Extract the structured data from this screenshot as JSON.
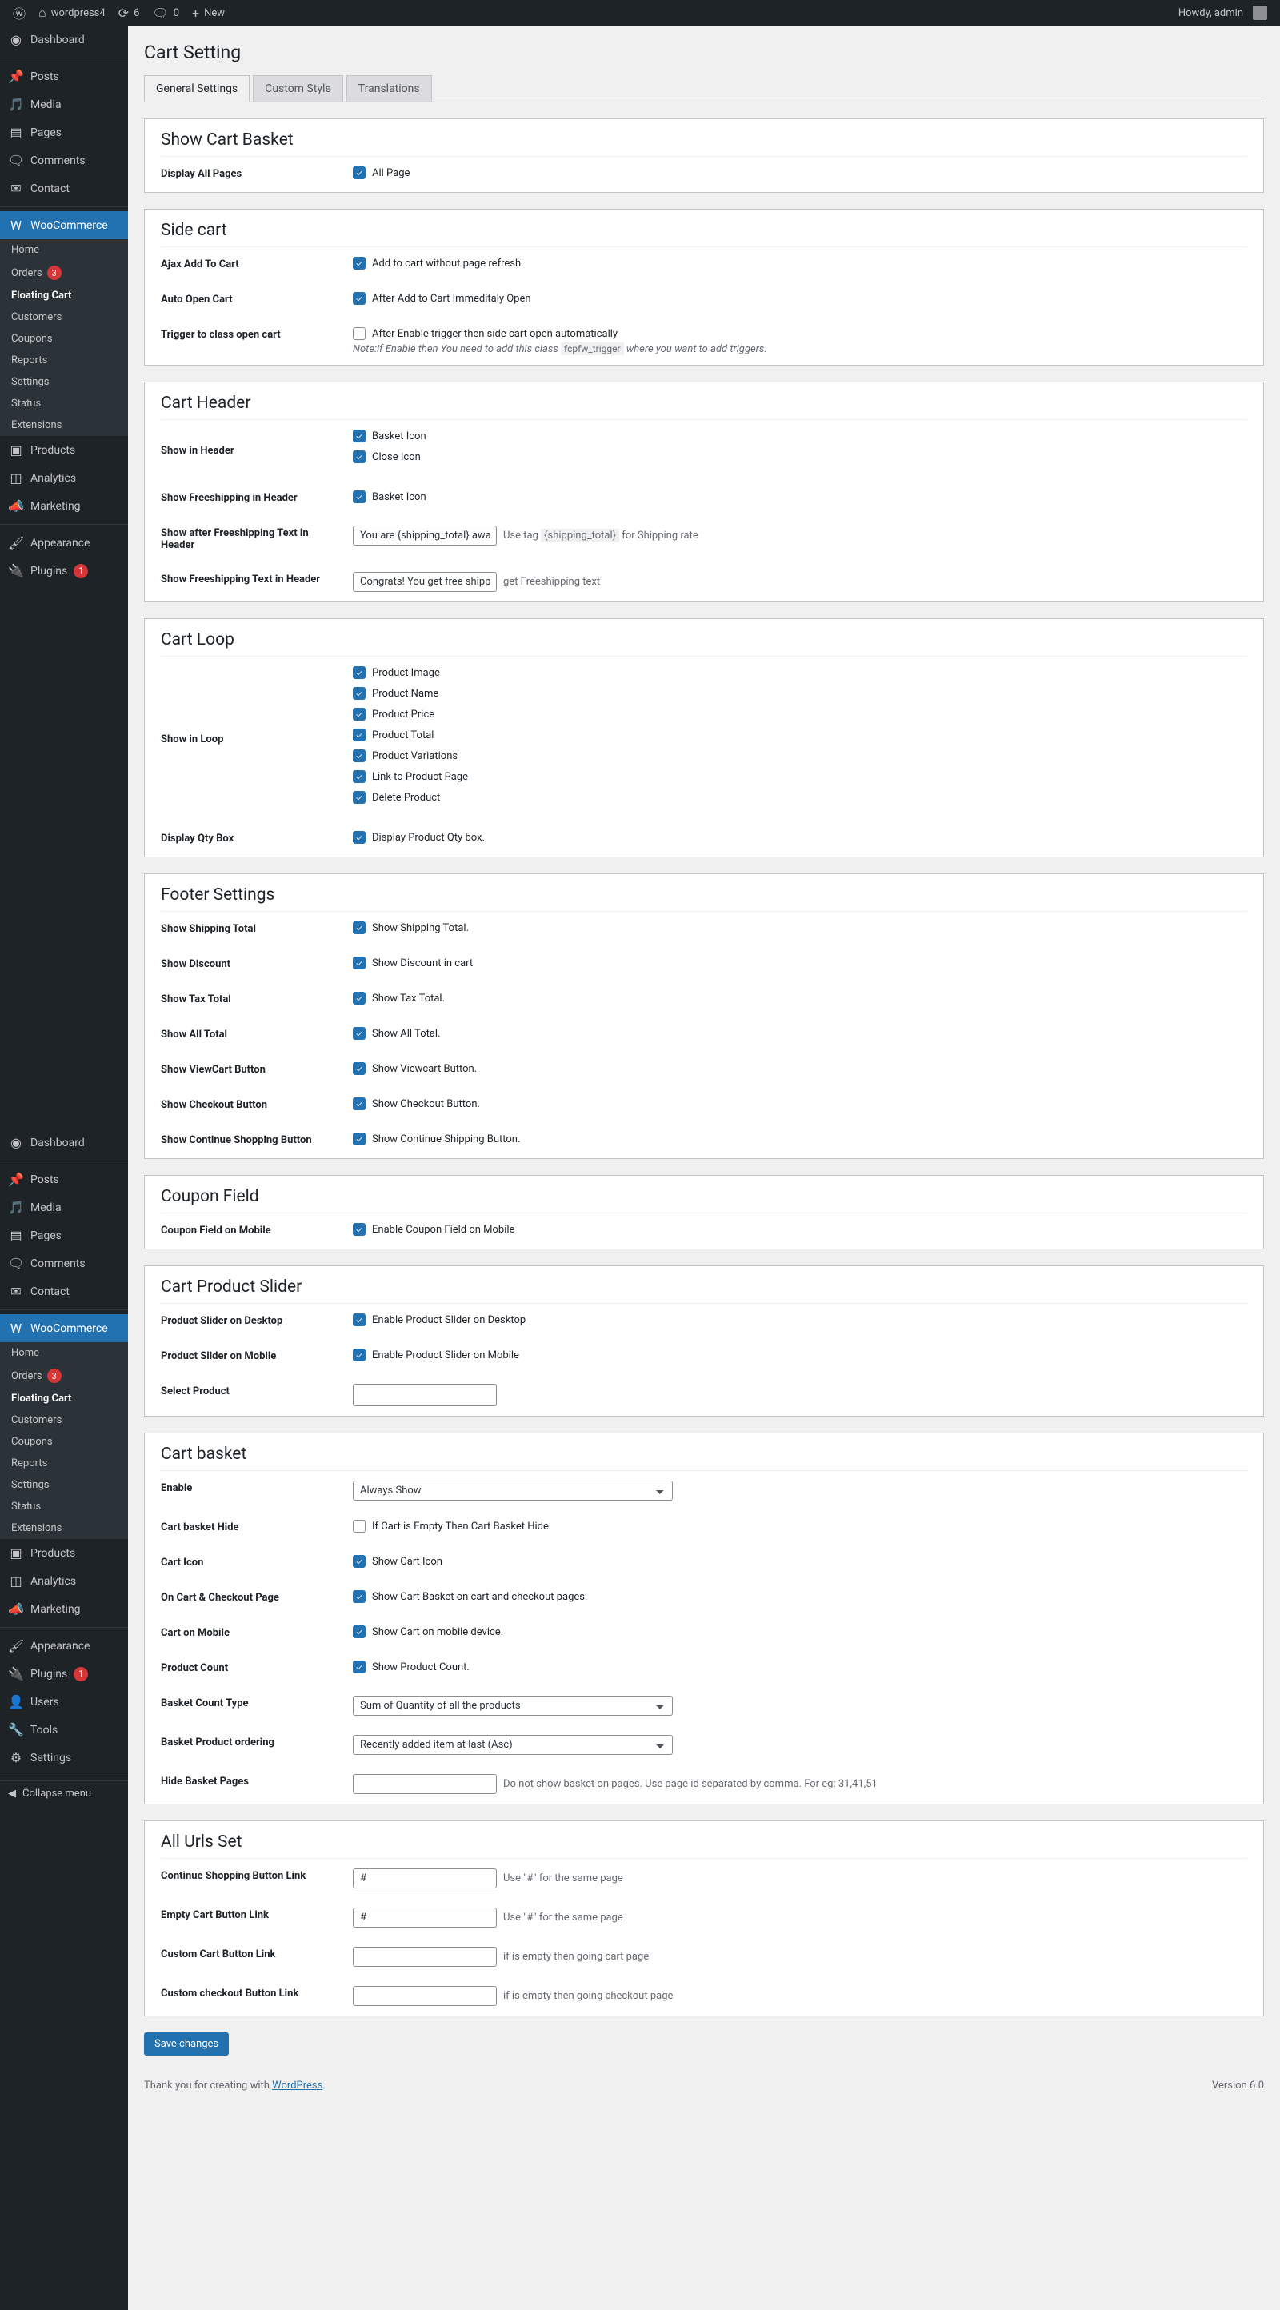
{
  "toolbar": {
    "site_name": "wordpress4",
    "updates_count": "6",
    "comments_count": "0",
    "new_label": "New",
    "howdy": "Howdy, admin"
  },
  "sidebar_primary": [
    {
      "icon": "dashboard",
      "label": "Dashboard",
      "name": "dashboard"
    },
    {
      "sep": true
    },
    {
      "icon": "pin",
      "label": "Posts",
      "name": "posts"
    },
    {
      "icon": "media",
      "label": "Media",
      "name": "media"
    },
    {
      "icon": "page",
      "label": "Pages",
      "name": "pages"
    },
    {
      "icon": "comment",
      "label": "Comments",
      "name": "comments"
    },
    {
      "icon": "mail",
      "label": "Contact",
      "name": "contact"
    },
    {
      "sep": true
    },
    {
      "icon": "woo",
      "label": "WooCommerce",
      "name": "woocommerce",
      "current": true
    },
    {
      "submenu": [
        {
          "label": "Home",
          "name": "woo-home"
        },
        {
          "label": "Orders",
          "name": "woo-orders",
          "badge": "3"
        },
        {
          "label": "Floating Cart",
          "name": "woo-floating-cart",
          "current": true
        },
        {
          "label": "Customers",
          "name": "woo-customers"
        },
        {
          "label": "Coupons",
          "name": "woo-coupons"
        },
        {
          "label": "Reports",
          "name": "woo-reports"
        },
        {
          "label": "Settings",
          "name": "woo-settings"
        },
        {
          "label": "Status",
          "name": "woo-status"
        },
        {
          "label": "Extensions",
          "name": "woo-extensions"
        }
      ]
    },
    {
      "icon": "box",
      "label": "Products",
      "name": "products"
    },
    {
      "icon": "bars",
      "label": "Analytics",
      "name": "analytics"
    },
    {
      "icon": "mega",
      "label": "Marketing",
      "name": "marketing"
    },
    {
      "sep": true
    },
    {
      "icon": "brush",
      "label": "Appearance",
      "name": "appearance"
    },
    {
      "icon": "plug",
      "label": "Plugins",
      "name": "plugins",
      "badge": "1"
    }
  ],
  "sidebar_secondary": [
    {
      "icon": "dashboard",
      "label": "Dashboard",
      "name": "dashboard2"
    },
    {
      "sep": true
    },
    {
      "icon": "pin",
      "label": "Posts",
      "name": "posts2"
    },
    {
      "icon": "media",
      "label": "Media",
      "name": "media2"
    },
    {
      "icon": "page",
      "label": "Pages",
      "name": "pages2"
    },
    {
      "icon": "comment",
      "label": "Comments",
      "name": "comments2"
    },
    {
      "icon": "mail",
      "label": "Contact",
      "name": "contact2"
    },
    {
      "sep": true
    },
    {
      "icon": "woo",
      "label": "WooCommerce",
      "name": "woocommerce2",
      "current": true
    },
    {
      "submenu": [
        {
          "label": "Home",
          "name": "woo-home2"
        },
        {
          "label": "Orders",
          "name": "woo-orders2",
          "badge": "3"
        },
        {
          "label": "Floating Cart",
          "name": "woo-floating-cart2",
          "current": true
        },
        {
          "label": "Customers",
          "name": "woo-customers2"
        },
        {
          "label": "Coupons",
          "name": "woo-coupons2"
        },
        {
          "label": "Reports",
          "name": "woo-reports2"
        },
        {
          "label": "Settings",
          "name": "woo-settings2"
        },
        {
          "label": "Status",
          "name": "woo-status2"
        },
        {
          "label": "Extensions",
          "name": "woo-extensions2"
        }
      ]
    },
    {
      "icon": "box",
      "label": "Products",
      "name": "products2"
    },
    {
      "icon": "bars",
      "label": "Analytics",
      "name": "analytics2"
    },
    {
      "icon": "mega",
      "label": "Marketing",
      "name": "marketing2"
    },
    {
      "sep": true
    },
    {
      "icon": "brush",
      "label": "Appearance",
      "name": "appearance2"
    },
    {
      "icon": "plug",
      "label": "Plugins",
      "name": "plugins2",
      "badge": "1"
    },
    {
      "icon": "user",
      "label": "Users",
      "name": "users"
    },
    {
      "icon": "wrench",
      "label": "Tools",
      "name": "tools"
    },
    {
      "icon": "sliders",
      "label": "Settings",
      "name": "settings"
    },
    {
      "sep": true
    }
  ],
  "collapse_menu": "Collapse menu",
  "page": {
    "title": "Cart Setting",
    "tabs": [
      "General Settings",
      "Custom Style",
      "Translations"
    ],
    "tab_active": 0
  },
  "sections": {
    "show_cart_basket": {
      "title": "Show Cart Basket",
      "rows": [
        {
          "label": "Display All Pages",
          "items": [
            {
              "checked": true,
              "text": "All Page"
            }
          ]
        }
      ]
    },
    "side_cart": {
      "title": "Side cart",
      "rows": [
        {
          "label": "Ajax Add To Cart",
          "items": [
            {
              "checked": true,
              "text": "Add to cart without page refresh."
            }
          ]
        },
        {
          "label": "Auto Open Cart",
          "items": [
            {
              "checked": true,
              "text": "After Add to Cart Immeditaly Open"
            }
          ]
        },
        {
          "label": "Trigger to class open cart",
          "items": [
            {
              "checked": false,
              "text": "After Enable trigger then side cart open automatically"
            }
          ],
          "note_html": "Note:if Enable then You need to add this class <code>fcpfw_trigger</code> where you want to add triggers."
        }
      ]
    },
    "cart_header": {
      "title": "Cart Header",
      "rows": [
        {
          "label": "Show in Header",
          "stacked": true,
          "items": [
            {
              "checked": true,
              "text": "Basket Icon"
            },
            {
              "checked": true,
              "text": "Close Icon"
            }
          ]
        },
        {
          "label": "Show Freeshipping in Header",
          "items": [
            {
              "checked": true,
              "text": "Basket Icon"
            }
          ]
        },
        {
          "label": "Show after Freeshipping Text in Header",
          "input": {
            "value": "You are {shipping_total} away"
          },
          "after_html": "Use tag <code>{shipping_total}</code> for Shipping rate"
        },
        {
          "label": "Show Freeshipping Text in Header",
          "input": {
            "value": "Congrats! You get free shipping"
          },
          "after": "get Freeshipping text"
        }
      ]
    },
    "cart_loop": {
      "title": "Cart Loop",
      "rows": [
        {
          "label": "Show in Loop",
          "stacked": true,
          "items": [
            {
              "checked": true,
              "text": "Product Image"
            },
            {
              "checked": true,
              "text": "Product Name"
            },
            {
              "checked": true,
              "text": "Product Price"
            },
            {
              "checked": true,
              "text": "Product Total"
            },
            {
              "checked": true,
              "text": "Product Variations"
            },
            {
              "checked": true,
              "text": "Link to Product Page"
            },
            {
              "checked": true,
              "text": "Delete Product"
            }
          ]
        },
        {
          "label": "Display Qty Box",
          "items": [
            {
              "checked": true,
              "text": "Display Product Qty box."
            }
          ]
        }
      ]
    },
    "footer_settings": {
      "title": "Footer Settings",
      "rows": [
        {
          "label": "Show Shipping Total",
          "items": [
            {
              "checked": true,
              "text": "Show Shipping Total."
            }
          ]
        },
        {
          "label": "Show Discount",
          "items": [
            {
              "checked": true,
              "text": "Show Discount in cart"
            }
          ]
        },
        {
          "label": "Show Tax Total",
          "items": [
            {
              "checked": true,
              "text": "Show Tax Total."
            }
          ]
        },
        {
          "label": "Show All Total",
          "items": [
            {
              "checked": true,
              "text": "Show All Total."
            }
          ]
        },
        {
          "label": "Show ViewCart Button",
          "items": [
            {
              "checked": true,
              "text": "Show Viewcart Button."
            }
          ]
        },
        {
          "label": "Show Checkout Button",
          "items": [
            {
              "checked": true,
              "text": "Show Checkout Button."
            }
          ]
        },
        {
          "label": "Show Continue Shopping Button",
          "items": [
            {
              "checked": true,
              "text": "Show Continue Shipping Button."
            }
          ]
        }
      ]
    },
    "coupon_field": {
      "title": "Coupon Field",
      "rows": [
        {
          "label": "Coupon Field on Mobile",
          "items": [
            {
              "checked": true,
              "text": "Enable Coupon Field on Mobile"
            }
          ]
        }
      ]
    },
    "cart_product_slider": {
      "title": "Cart Product Slider",
      "rows": [
        {
          "label": "Product Slider on Desktop",
          "items": [
            {
              "checked": true,
              "text": "Enable Product Slider on Desktop"
            }
          ]
        },
        {
          "label": "Product Slider on Mobile",
          "items": [
            {
              "checked": true,
              "text": "Enable Product Slider on Mobile"
            }
          ]
        },
        {
          "label": "Select Product",
          "empty_input": true
        }
      ]
    },
    "cart_basket": {
      "title": "Cart basket",
      "rows": [
        {
          "label": "Enable",
          "select": {
            "value": "Always Show"
          }
        },
        {
          "label": "Cart basket Hide",
          "items": [
            {
              "checked": false,
              "text": "If Cart is Empty Then Cart Basket Hide"
            }
          ]
        },
        {
          "label": "Cart Icon",
          "items": [
            {
              "checked": true,
              "text": "Show Cart Icon"
            }
          ]
        },
        {
          "label": "On Cart & Checkout Page",
          "items": [
            {
              "checked": true,
              "text": "Show Cart Basket on cart and checkout pages."
            }
          ]
        },
        {
          "label": "Cart on Mobile",
          "items": [
            {
              "checked": true,
              "text": "Show Cart on mobile device."
            }
          ]
        },
        {
          "label": "Product Count",
          "items": [
            {
              "checked": true,
              "text": "Show Product Count."
            }
          ]
        },
        {
          "label": "Basket Count Type",
          "select": {
            "value": "Sum of Quantity of all the products"
          }
        },
        {
          "label": "Basket Product ordering",
          "select": {
            "value": "Recently added item at last (Asc)"
          }
        },
        {
          "label": "Hide Basket Pages",
          "input": {
            "value": ""
          },
          "after": "Do not show basket on pages. Use page id separated by comma. For eg: 31,41,51"
        }
      ]
    },
    "all_urls_set": {
      "title": "All Urls Set",
      "rows": [
        {
          "label": "Continue Shopping Button Link",
          "input": {
            "value": "#"
          },
          "after": "Use \"#\" for the same page"
        },
        {
          "label": "Empty Cart Button Link",
          "input": {
            "value": "#"
          },
          "after": "Use \"#\" for the same page"
        },
        {
          "label": "Custom Cart Button Link",
          "input": {
            "value": ""
          },
          "after": "if is empty then going cart page"
        },
        {
          "label": "Custom checkout Button Link",
          "input": {
            "value": ""
          },
          "after": "if is empty then going checkout page"
        }
      ]
    }
  },
  "save_button": "Save changes",
  "footer": {
    "thanks_pre": "Thank you for creating with ",
    "thanks_link": "WordPress",
    "thanks_post": ".",
    "version": "Version 6.0"
  }
}
